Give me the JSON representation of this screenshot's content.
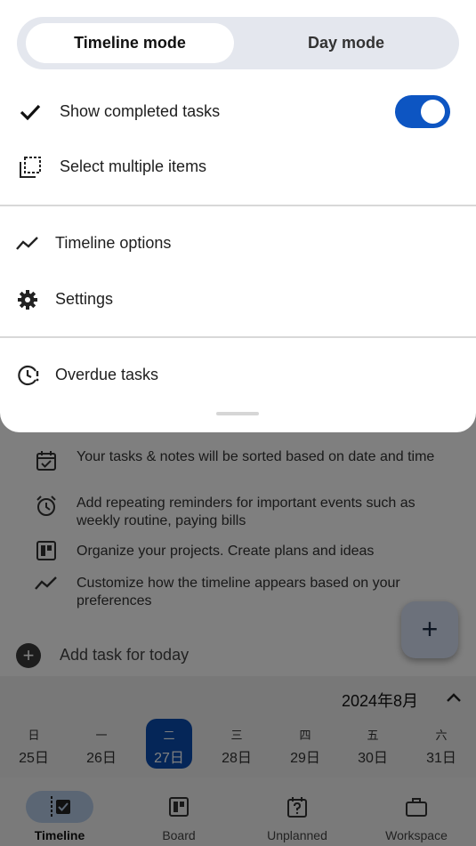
{
  "mode_switch": {
    "timeline": "Timeline mode",
    "day": "Day mode",
    "active": "timeline"
  },
  "menu": {
    "show_completed": "Show completed tasks",
    "show_completed_on": true,
    "select_multiple": "Select multiple items",
    "timeline_options": "Timeline options",
    "settings": "Settings",
    "overdue": "Overdue tasks"
  },
  "tips": [
    {
      "icon": "calendar-check-icon",
      "text": "Your tasks & notes will be sorted based on date and time"
    },
    {
      "icon": "alarm-icon",
      "text": "Add repeating reminders for important events such as weekly routine, paying bills"
    },
    {
      "icon": "board-icon",
      "text": "Organize your projects. Create plans and ideas"
    },
    {
      "icon": "trend-icon",
      "text": "Customize how the timeline appears based on your preferences"
    }
  ],
  "add_task": {
    "label": "Add task for today",
    "fab": "+"
  },
  "calendar": {
    "month": "2024年8月",
    "days": [
      {
        "dow": "日",
        "date": "25日"
      },
      {
        "dow": "一",
        "date": "26日"
      },
      {
        "dow": "二",
        "date": "27日",
        "selected": true
      },
      {
        "dow": "三",
        "date": "28日"
      },
      {
        "dow": "四",
        "date": "29日"
      },
      {
        "dow": "五",
        "date": "30日"
      },
      {
        "dow": "六",
        "date": "31日"
      }
    ]
  },
  "nav": {
    "timeline": "Timeline",
    "board": "Board",
    "unplanned": "Unplanned",
    "workspace": "Workspace",
    "active": "timeline"
  },
  "colors": {
    "accent": "#0d55c2",
    "selected_day": "#0a4cb0",
    "mode_switch_bg": "#e4e7ee",
    "active_nav_pill": "#b7cde9"
  }
}
